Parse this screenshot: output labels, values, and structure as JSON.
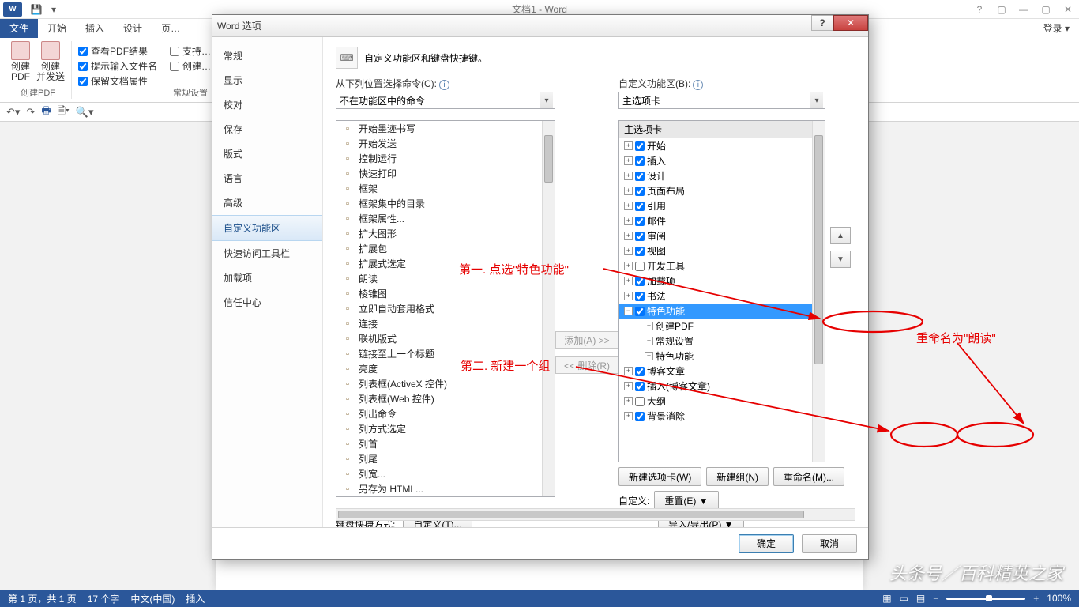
{
  "titlebar": {
    "app_icon": "W",
    "title": "文档1 - Word",
    "login": "登录"
  },
  "win_controls": {
    "help": "?",
    "ribbon": "▢",
    "min": "—",
    "restore": "▢",
    "close": "✕"
  },
  "ribbon_tabs": {
    "file": "文件",
    "home": "开始",
    "insert": "插入",
    "design": "设计",
    "layout": "页…",
    "login_caret": "▾"
  },
  "ribbon": {
    "pdf_group": "创建PDF",
    "btn1": "创建\nPDF",
    "btn2": "创建\n并发送",
    "checks": [
      "查看PDF结果",
      "提示输入文件名",
      "保留文档属性"
    ],
    "col2_checks": [
      "支持…",
      "创建…"
    ],
    "settings_group": "常规设置"
  },
  "statusbar": {
    "page": "第 1 页，共 1 页",
    "words": "17 个字",
    "lang": "中文(中国)",
    "mode": "插入",
    "zoom": "100%"
  },
  "watermark": "头条号／百科精英之家",
  "dialog": {
    "title": "Word 选项",
    "nav": [
      "常规",
      "显示",
      "校对",
      "保存",
      "版式",
      "语言",
      "高级",
      "自定义功能区",
      "快速访问工具栏",
      "加载项",
      "信任中心"
    ],
    "nav_selected": 7,
    "pane_title": "自定义功能区和键盘快捷键。",
    "left_label": "从下列位置选择命令(C):",
    "left_combo": "不在功能区中的命令",
    "right_label": "自定义功能区(B):",
    "right_combo": "主选项卡",
    "left_list": [
      "开始墨迹书写",
      "开始发送",
      "控制运行",
      "快速打印",
      "框架",
      "框架集中的目录",
      "框架属性...",
      "扩大图形",
      "扩展包",
      "扩展式选定",
      "朗读",
      "棱锥图",
      "立即自动套用格式",
      "连接",
      "联机版式",
      "链接至上一个标题",
      "亮度",
      "列表框(ActiveX 控件)",
      "列表框(Web 控件)",
      "列出命令",
      "列方式选定",
      "列首",
      "列尾",
      "列宽...",
      "另存为 HTML..."
    ],
    "add_btn": "添加(A) >>",
    "remove_btn": "<< 删除(R)",
    "tree_header": "主选项卡",
    "tree": [
      {
        "lv": 1,
        "exp": "+",
        "chk": true,
        "label": "开始"
      },
      {
        "lv": 1,
        "exp": "+",
        "chk": true,
        "label": "插入"
      },
      {
        "lv": 1,
        "exp": "+",
        "chk": true,
        "label": "设计"
      },
      {
        "lv": 1,
        "exp": "+",
        "chk": true,
        "label": "页面布局"
      },
      {
        "lv": 1,
        "exp": "+",
        "chk": true,
        "label": "引用"
      },
      {
        "lv": 1,
        "exp": "+",
        "chk": true,
        "label": "邮件"
      },
      {
        "lv": 1,
        "exp": "+",
        "chk": true,
        "label": "审阅"
      },
      {
        "lv": 1,
        "exp": "+",
        "chk": true,
        "label": "视图"
      },
      {
        "lv": 1,
        "exp": "+",
        "chk": false,
        "label": "开发工具"
      },
      {
        "lv": 1,
        "exp": "+",
        "chk": true,
        "label": "加载项"
      },
      {
        "lv": 1,
        "exp": "+",
        "chk": true,
        "label": "书法"
      },
      {
        "lv": 1,
        "exp": "−",
        "chk": true,
        "label": "特色功能",
        "sel": true
      },
      {
        "lv": 2,
        "exp": "+",
        "label": "创建PDF"
      },
      {
        "lv": 2,
        "exp": "+",
        "label": "常规设置"
      },
      {
        "lv": 2,
        "exp": "+",
        "label": "特色功能"
      },
      {
        "lv": 1,
        "exp": "+",
        "chk": true,
        "label": "博客文章"
      },
      {
        "lv": 1,
        "exp": "+",
        "chk": true,
        "label": "插入(博客文章)"
      },
      {
        "lv": 1,
        "exp": "+",
        "chk": false,
        "label": "大纲"
      },
      {
        "lv": 1,
        "exp": "+",
        "chk": true,
        "label": "背景消除"
      }
    ],
    "new_tab_btn": "新建选项卡(W)",
    "new_group_btn": "新建组(N)",
    "rename_btn": "重命名(M)...",
    "custom_label": "自定义:",
    "reset_btn": "重置(E)",
    "import_btn": "导入/导出(P)",
    "shortcut_label": "键盘快捷方式:",
    "shortcut_btn": "自定义(T)...",
    "ok": "确定",
    "cancel": "取消"
  },
  "annotations": {
    "a1": "第一. 点选\"特色功能\"",
    "a2": "第二. 新建一个组",
    "a3": "重命名为\"朗读\""
  }
}
